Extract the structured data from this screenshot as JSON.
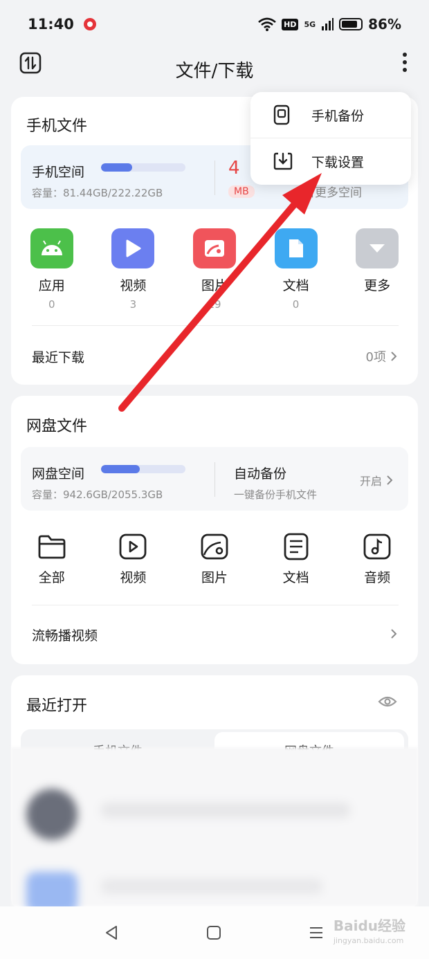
{
  "status_bar": {
    "time": "11:40",
    "hd_label": "HD",
    "network": "5G",
    "battery": "86%"
  },
  "header": {
    "title": "文件/下载"
  },
  "phone_files": {
    "title": "手机文件",
    "space_label": "手机空间",
    "space_used_fraction": 0.37,
    "capacity": "容量：81.44GB/222.22GB",
    "free_value_partial": "4",
    "free_unit": "MB",
    "free_hint_partial": "省更多空间",
    "categories": [
      {
        "label": "应用",
        "count": "0",
        "color": "#4cc04a",
        "icon": "android-icon"
      },
      {
        "label": "视频",
        "count": "3",
        "color": "#6b7ff0",
        "icon": "play-icon"
      },
      {
        "label": "图片",
        "count": "19",
        "color": "#f0545b",
        "icon": "image-icon"
      },
      {
        "label": "文档",
        "count": "0",
        "color": "#3ea9f2",
        "icon": "document-icon"
      },
      {
        "label": "更多",
        "count": "",
        "color": "#c9ccd2",
        "icon": "chevron-down-icon"
      }
    ],
    "recent_download_label": "最近下载",
    "recent_download_value": "0项"
  },
  "cloud_files": {
    "title": "网盘文件",
    "space_label": "网盘空间",
    "space_used_fraction": 0.46,
    "capacity": "容量：942.6GB/2055.3GB",
    "auto_backup_label": "自动备份",
    "auto_backup_sub": "一键备份手机文件",
    "auto_backup_action": "开启",
    "categories": [
      {
        "label": "全部",
        "icon": "folder-icon"
      },
      {
        "label": "视频",
        "icon": "video-icon"
      },
      {
        "label": "图片",
        "icon": "image-icon"
      },
      {
        "label": "文档",
        "icon": "document-icon"
      },
      {
        "label": "音频",
        "icon": "music-icon"
      }
    ],
    "stream_label": "流畅播视频"
  },
  "recent_open": {
    "title": "最近打开",
    "tabs": [
      "手机文件",
      "网盘文件"
    ]
  },
  "menu": {
    "items": [
      "手机备份",
      "下载设置"
    ]
  },
  "watermark": {
    "brand": "Baidu经验",
    "url": "jingyan.baidu.com"
  },
  "colors": {
    "accent_bar": "#5b7ae8",
    "arrow": "#e8262b",
    "free_red": "#e64545"
  }
}
